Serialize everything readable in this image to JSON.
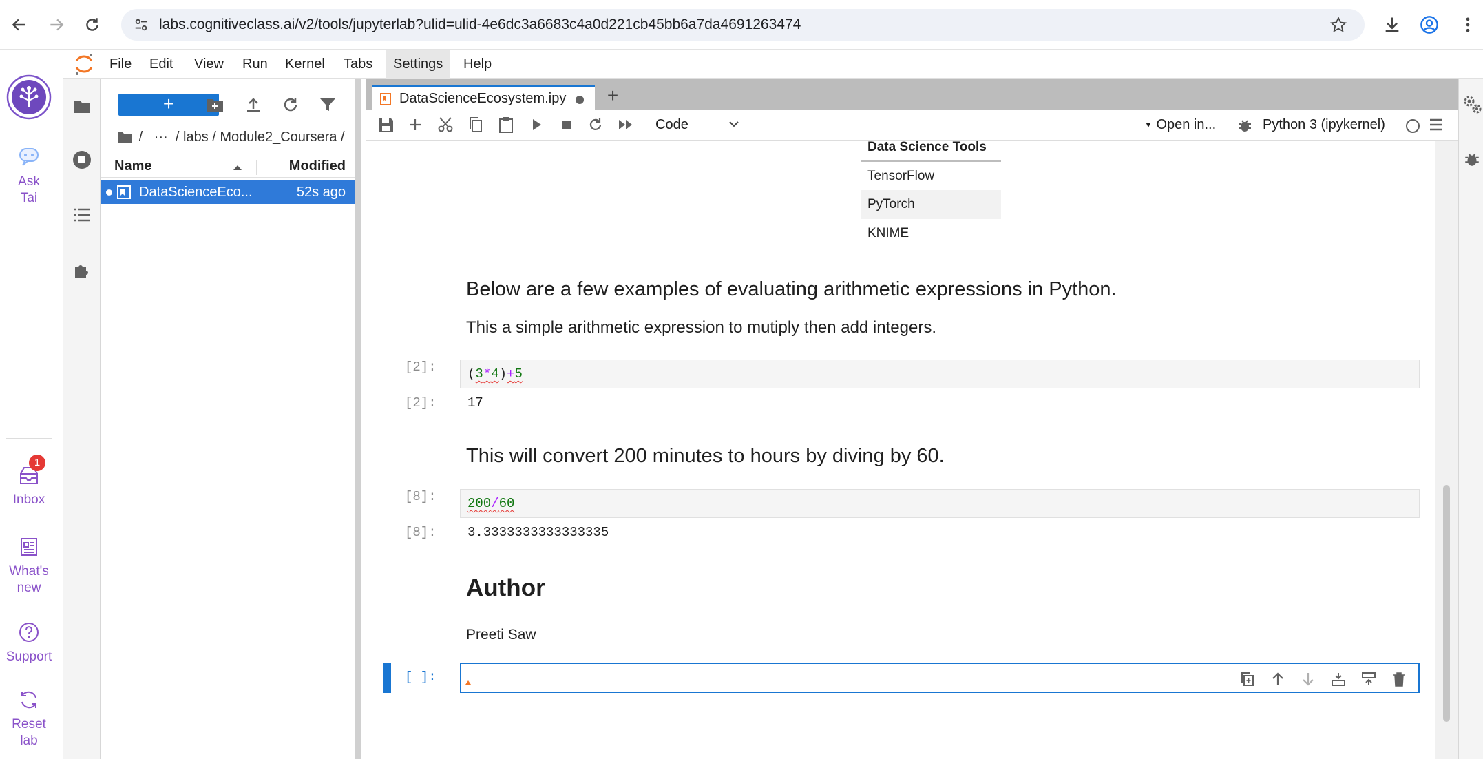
{
  "browser": {
    "url": "labs.cognitiveclass.ai/v2/tools/jupyterlab?ulid=ulid-4e6dc3a6683c4a0d221cb45bb6a7da4691263474"
  },
  "extensions": {
    "ask": "Ask\nTai",
    "inbox": "Inbox",
    "inbox_badge": "1",
    "whats_new": "What's\nnew",
    "support": "Support",
    "reset": "Reset\nlab"
  },
  "menu": [
    "File",
    "Edit",
    "View",
    "Run",
    "Kernel",
    "Tabs",
    "Settings",
    "Help"
  ],
  "file_browser": {
    "new_label": "+",
    "breadcrumb": "/   ···  / labs / Module2_Coursera /",
    "col_name": "Name",
    "col_modified": "Modified",
    "file_name": "DataScienceEco...",
    "file_modified": "52s ago"
  },
  "notebook": {
    "tab_title": "DataScienceEcosystem.ipy",
    "tab_add": "+",
    "cell_type": "Code",
    "open_in": "Open in...",
    "kernel": "Python 3 (ipykernel)",
    "table": {
      "header": "Data Science Tools",
      "rows": [
        "TensorFlow",
        "PyTorch",
        "KNIME"
      ]
    },
    "heading_examples": "Below are a few examples of evaluating arithmetic expressions in Python.",
    "para_simple": "This a simple arithmetic expression to mutiply then add integers.",
    "cell1": {
      "prompt": "[2]:",
      "out_prompt": "[2]:",
      "output": "17"
    },
    "heading_convert": "This will convert 200 minutes to hours by diving by 60.",
    "cell2": {
      "prompt": "[8]:",
      "out_prompt": "[8]:",
      "output": "3.3333333333333335"
    },
    "author_heading": "Author",
    "author_name": "Preeti Saw",
    "empty_prompt": "[ ]:"
  }
}
